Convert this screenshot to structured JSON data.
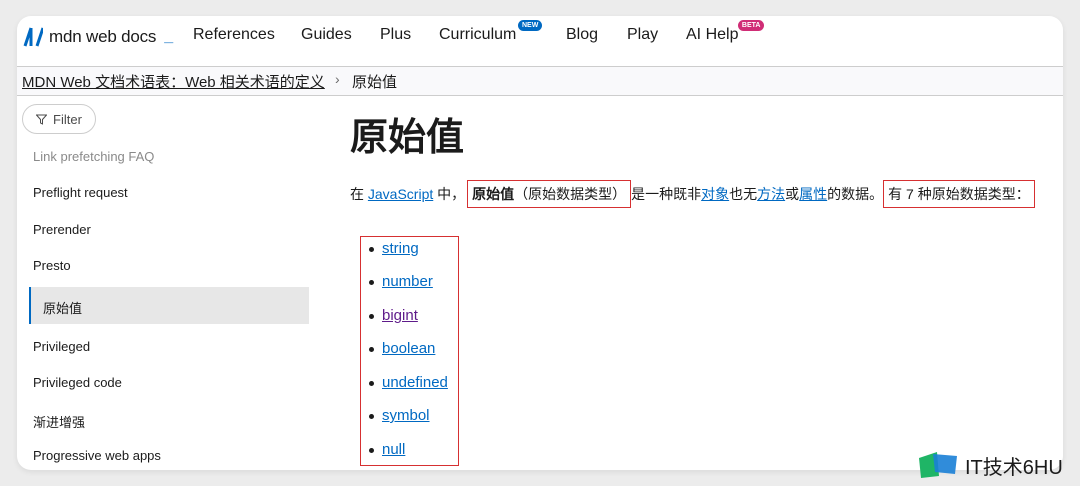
{
  "nav": {
    "logo_text": "mdn web docs",
    "items": [
      {
        "label": "References"
      },
      {
        "label": "Guides"
      },
      {
        "label": "Plus"
      },
      {
        "label": "Curriculum",
        "badge": "NEW"
      },
      {
        "label": "Blog"
      },
      {
        "label": "Play"
      },
      {
        "label": "AI Help",
        "badge": "BETA"
      }
    ]
  },
  "breadcrumb": {
    "parent": "MDN Web 文档术语表：Web 相关术语的定义",
    "separator": "›",
    "current": "原始值"
  },
  "sidebar": {
    "filter_label": "Filter",
    "items": [
      {
        "label": "Link prefetching FAQ"
      },
      {
        "label": "Preflight request"
      },
      {
        "label": "Prerender"
      },
      {
        "label": "Presto"
      },
      {
        "label": "原始值",
        "active": true
      },
      {
        "label": "Privileged"
      },
      {
        "label": "Privileged code"
      },
      {
        "label": "渐进增强"
      },
      {
        "label": "Progressive web apps"
      }
    ]
  },
  "main": {
    "title": "原始值",
    "para": {
      "t1": "在 ",
      "link_js": "JavaScript",
      "t2": " 中，",
      "bold": "原始值",
      "t3": "（原始数据类型）",
      "t4": "是一种既非",
      "link_obj": "对象",
      "t5": "也无",
      "link_method": "方法",
      "t6": "或",
      "link_prop": "属性",
      "t7": "的数据。",
      "t8": "有 7 种原始数据类型："
    },
    "types": [
      "string",
      "number",
      "bigint",
      "boolean",
      "undefined",
      "symbol",
      "null"
    ]
  },
  "watermark": {
    "text": "IT技术6HU"
  },
  "colors": {
    "accent": "#0069c2",
    "highlight_box": "#d63031",
    "visited_link": "#5e1b8a"
  }
}
